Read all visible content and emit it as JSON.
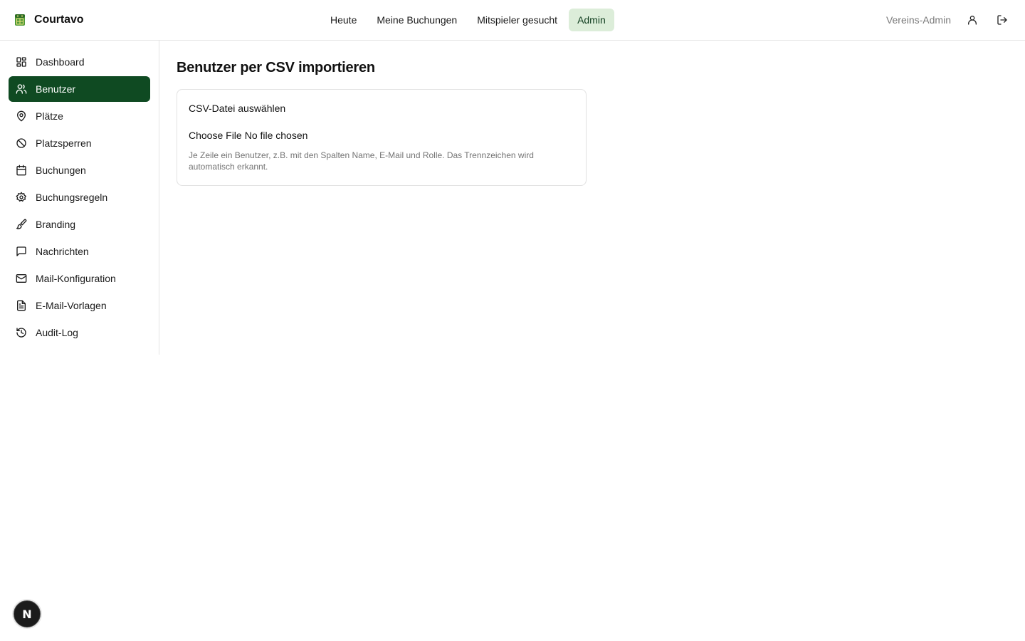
{
  "app": {
    "name": "Courtavo",
    "logo_icon": "tennis-court-icon",
    "accent": "#0f4a22",
    "accent_light": "#dcedd9"
  },
  "topnav": {
    "items": [
      {
        "label": "Heute",
        "active": false
      },
      {
        "label": "Meine Buchungen",
        "active": false
      },
      {
        "label": "Mitspieler gesucht",
        "active": false
      },
      {
        "label": "Admin",
        "active": true
      }
    ]
  },
  "user": {
    "role": "Vereins-Admin",
    "profile_icon": "user-icon",
    "logout_icon": "logout-icon"
  },
  "sidebar": {
    "items": [
      {
        "label": "Dashboard",
        "icon": "dashboard-icon",
        "active": false
      },
      {
        "label": "Benutzer",
        "icon": "users-icon",
        "active": true
      },
      {
        "label": "Plätze",
        "icon": "map-pin-icon",
        "active": false
      },
      {
        "label": "Platzsperren",
        "icon": "ban-icon",
        "active": false
      },
      {
        "label": "Buchungen",
        "icon": "calendar-icon",
        "active": false
      },
      {
        "label": "Buchungsregeln",
        "icon": "gear-icon",
        "active": false
      },
      {
        "label": "Branding",
        "icon": "paintbrush-icon",
        "active": false
      },
      {
        "label": "Nachrichten",
        "icon": "message-icon",
        "active": false
      },
      {
        "label": "Mail-Konfiguration",
        "icon": "mail-icon",
        "active": false
      },
      {
        "label": "E-Mail-Vorlagen",
        "icon": "file-text-icon",
        "active": false
      },
      {
        "label": "Audit-Log",
        "icon": "history-icon",
        "active": false
      }
    ]
  },
  "main": {
    "title": "Benutzer per CSV importieren",
    "card": {
      "label": "CSV-Datei auswählen",
      "file_button": "Choose File",
      "file_status": "No file chosen",
      "help": "Je Zeile ein Benutzer, z.B. mit den Spalten Name, E-Mail und Rolle. Das Trennzeichen wird automatisch erkannt."
    }
  },
  "dev_badge": {
    "letter": "N"
  }
}
